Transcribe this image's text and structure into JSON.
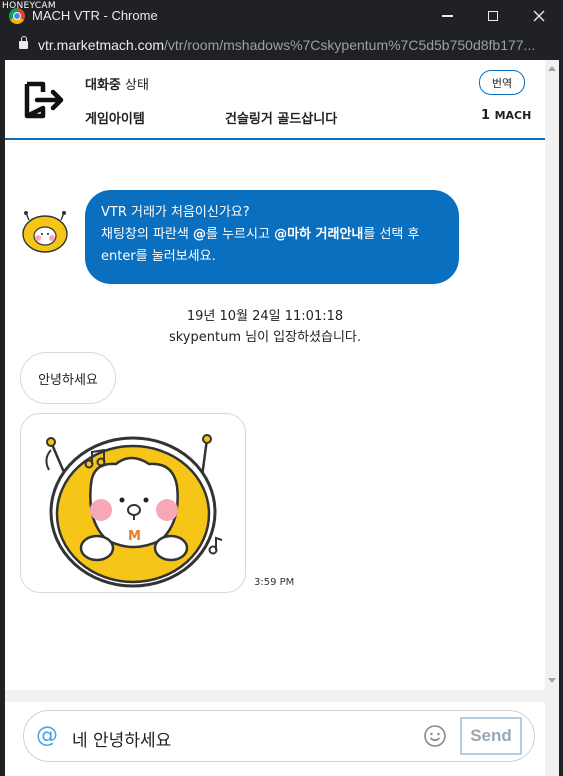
{
  "browser": {
    "watermark": "HONEYCAM",
    "title": "MACH VTR - Chrome",
    "url_host": "vtr.marketmach.com",
    "url_path": "/vtr/room/mshadows%7Cskypentum%7C5d5b750d8fb177..."
  },
  "header": {
    "status_bold": "대화중",
    "status_text": "상태",
    "item_label": "게임아이템",
    "item_name": "건슬링거 골드삽니다",
    "translate_label": "번역",
    "price_value": "1",
    "price_unit": "MACH"
  },
  "chat": {
    "bot_line1": "VTR 거래가 처음이신가요?",
    "bot_line2_a": "채팅창의 파란색 ",
    "bot_line2_b": "@",
    "bot_line2_c": "를 누르시고 ",
    "bot_line2_d": "@마하 거래안내",
    "bot_line2_e": "를 선택 후",
    "bot_line3": "enter를 눌러보세요.",
    "system_date": "19년 10월 24일 11:01:18",
    "system_enter": "skypentum 님이 입장하셨습니다.",
    "message_text": "안녕하세요",
    "sticker_letter": "M",
    "message_time": "3:59 PM"
  },
  "composer": {
    "at_symbol": "@",
    "input_value": "네 안녕하세요",
    "send_label": "Send"
  },
  "colors": {
    "accent": "#0b6fbf",
    "sticker_yellow": "#f5c518"
  }
}
